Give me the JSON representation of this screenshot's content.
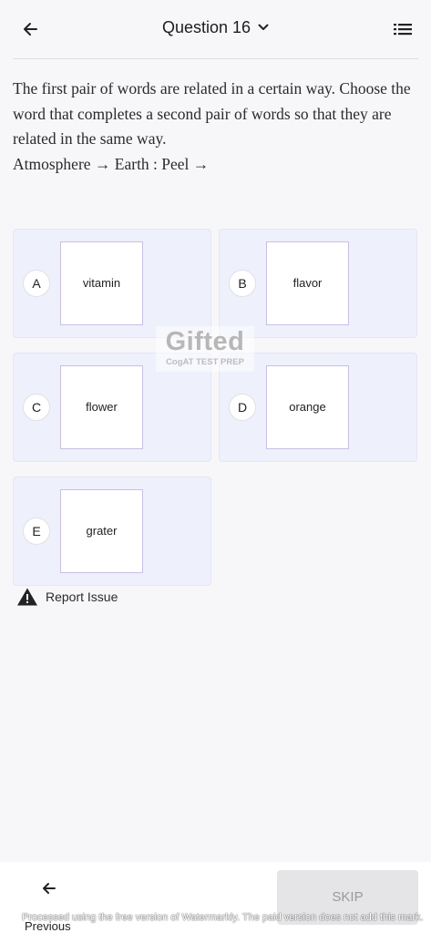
{
  "header": {
    "title": "Question 16",
    "back_icon": "arrow-left-icon",
    "dropdown_icon": "chevron-down-icon",
    "menu_icon": "list-icon"
  },
  "question": {
    "text": "The first pair of words are related in a certain way. Choose the word that completes a second pair of words so that they are related in the same way.",
    "analogy": "Atmosphere → Earth : Peel →"
  },
  "options": [
    {
      "letter": "A",
      "word": "vitamin"
    },
    {
      "letter": "B",
      "word": "flavor"
    },
    {
      "letter": "C",
      "word": "flower"
    },
    {
      "letter": "D",
      "word": "orange"
    },
    {
      "letter": "E",
      "word": "grater"
    }
  ],
  "watermark": {
    "brand": "Gifted",
    "tagline": "CogAT TEST PREP"
  },
  "report": {
    "label": "Report Issue",
    "icon": "warning-icon"
  },
  "footer": {
    "previous_label": "Previous",
    "skip_label": "SKIP",
    "processed_note": "Processed using the free version of Watermarkly. The paid version does not add this mark."
  },
  "colors": {
    "background": "#f7f7fa",
    "card_background": "#eef0fb",
    "word_box_border": "#c9bfe6",
    "skip_background": "#e5e5e8"
  }
}
